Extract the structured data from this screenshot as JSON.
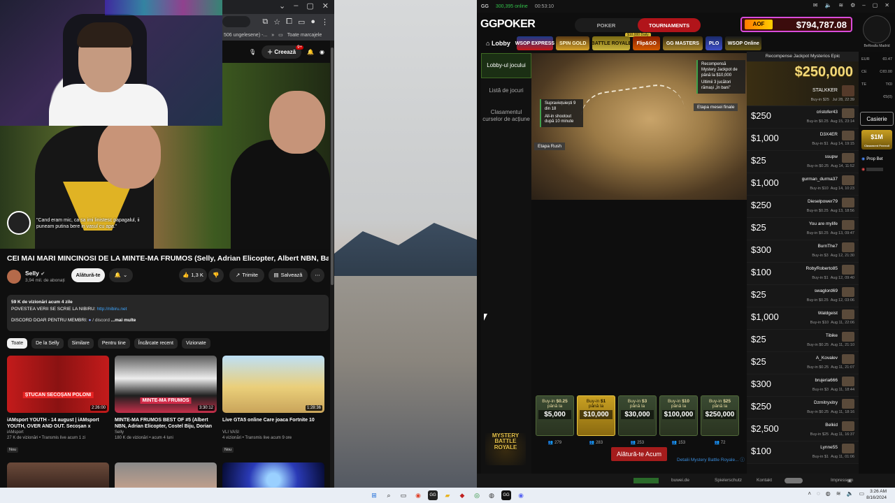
{
  "youtube": {
    "address_text": "506 ungelesene) -...",
    "bookmarks_label": "Toate marcajele",
    "create_label": "Creează",
    "notif_count": "9+",
    "subtitle": "\"Cand eram mic, ca sa imi linistesc papagalul, ii puneam putina bere in vasul cu apa.\"",
    "video_title": "CEI MAI MARI MINCINOSI DE LA MINTE-MA FRUMOS (Selly, Adrian Elicopter, Albert NBN, Babasha)",
    "channel": {
      "name": "Selly",
      "subs": "3,94 mil. de abonați",
      "join": "Alătură-te"
    },
    "actions": {
      "likes": "1,3 K",
      "share": "Trimite",
      "save": "Salvează"
    },
    "description": {
      "stats": "59 K de vizionări  acum 4 zile",
      "line1": "POVESTEA VERII SE SCRIE LA NIBIRU:",
      "link": "http://nibiru.net",
      "line2": "DISCORD DOAR PENTRU MEMBRI:",
      "line2_rest": "/ discord",
      "more": "...mai multe"
    },
    "chips": [
      "Toate",
      "De la Selly",
      "Similare",
      "Pentru tine",
      "Încărcate recent",
      "Vizionate"
    ],
    "videos": [
      {
        "title": "iAMsport YOUTH - 14 august | iAMsport YOUTH, OVER AND OUT. Secoșan x Știucan x ...",
        "channel": "iAMsport",
        "meta": "27 K de vizionări • Transmis live acum 1 zi",
        "badge": "Nou",
        "duration": "2:26:00",
        "thumb_label": "ȘTUCAN  SECOȘAN  POLONI"
      },
      {
        "title": "MINTE-MA FRUMOS BEST OF #5 (Albert NBN, Adrian Elicopter, Costel Biju, Dorian Popa & ...",
        "channel": "Selly",
        "meta": "180 K de vizionări • acum 4 luni",
        "badge": "",
        "duration": "3:30:12",
        "thumb_label": "MINTE-MA FRUMOS"
      },
      {
        "title": "Live GTA5 online Care joaca Fortnite 10",
        "channel": "VLI VASI",
        "meta": "4 vizionări • Transmis live acum 9 ore",
        "badge": "Nou",
        "duration": "1:28:36",
        "thumb_label": ""
      }
    ]
  },
  "gg": {
    "online": "300,395 online",
    "clock": "00:53:10",
    "logo": "GGPOKER",
    "tabs": [
      "POKER",
      "TOURNAMENTS"
    ],
    "jackpot": "$794,787.08",
    "club": "BeRealla Madrid",
    "nav": [
      "Lobby",
      "WSOP EXPRESS",
      "SPIN GOLD",
      "BATTLE ROYALE",
      "Flip&GO",
      "GG MASTERS",
      "PLO",
      "WSOP Online"
    ],
    "daily_tag": "$10,000 Daily",
    "side": [
      "Lobby-ul jocului",
      "Listă de jocuri",
      "Clasamentul curselor de acțiune"
    ],
    "mbr_logo": "MYSTERY BATTLE ROYALE",
    "map": {
      "tag1": "Recompensă Mystery Jackpot de până la $10,000",
      "tag2": "Ultimii 3 jucători rămași „în bani”",
      "tag3": "Supraviețuiești 9 din 18",
      "tag4": "All-in shootout după 10 minute",
      "etapa_rush": "Etapa Rush",
      "etapa_finala": "Etapa mesei finale"
    },
    "buyins": [
      {
        "buy": "$0.25",
        "upto": "$5,000",
        "entrants": "279"
      },
      {
        "buy": "$1",
        "upto": "$10,000",
        "entrants": "283"
      },
      {
        "buy": "$3",
        "upto": "$30,000",
        "entrants": "253"
      },
      {
        "buy": "$10",
        "upto": "$100,000",
        "entrants": "153"
      },
      {
        "buy": "$25",
        "upto": "$250,000",
        "entrants": "72"
      }
    ],
    "buyin_word": "Buy-in",
    "upto_word": "până la",
    "join_now": "Alătură-te Acum",
    "details_link": "Detalii Mystery Battle Royale...",
    "winners_header": "Recompense Jackpot Mysterios Epic",
    "top_winner": {
      "amount": "$250,000",
      "name": "STALKKER",
      "buyin": "$25",
      "date": "Jul 28, 22:39"
    },
    "winners": [
      {
        "amount": "$250",
        "name": "cristofer43",
        "buyin": "$0.25",
        "date": "Aug 15, 23:14"
      },
      {
        "amount": "$1,000",
        "name": "D3X4ER",
        "buyin": "$1",
        "date": "Aug 14, 19:15"
      },
      {
        "amount": "$25",
        "name": "ssupw",
        "buyin": "$0.25",
        "date": "Aug 14, 11:52"
      },
      {
        "amount": "$1,000",
        "name": "gurman_durma37",
        "buyin": "$10",
        "date": "Aug 14, 10:23"
      },
      {
        "amount": "$250",
        "name": "Dieselpower79",
        "buyin": "$0.25",
        "date": "Aug 13, 18:56"
      },
      {
        "amount": "$25",
        "name": "You are mylife",
        "buyin": "$0.25",
        "date": "Aug 13, 09:47"
      },
      {
        "amount": "$300",
        "name": "BurnThe7",
        "buyin": "$3",
        "date": "Aug 12, 21:30"
      },
      {
        "amount": "$100",
        "name": "RobyRoberto85",
        "buyin": "$1",
        "date": "Aug 12, 09:40"
      },
      {
        "amount": "$25",
        "name": "swaglord69",
        "buyin": "$0.25",
        "date": "Aug 12, 03:06"
      },
      {
        "amount": "$1,000",
        "name": "Waldgeist",
        "buyin": "$10",
        "date": "Aug 11, 22:06"
      },
      {
        "amount": "$25",
        "name": "Tibike",
        "buyin": "$0.25",
        "date": "Aug 11, 21:10"
      },
      {
        "amount": "$25",
        "name": "A_Kovalev",
        "buyin": "$0.25",
        "date": "Aug 11, 21:07"
      },
      {
        "amount": "$300",
        "name": "brujeria666",
        "buyin": "$3",
        "date": "Aug 11, 18:44"
      },
      {
        "amount": "$250",
        "name": "Dzmitryxitry",
        "buyin": "$0.25",
        "date": "Aug 11, 18:16"
      },
      {
        "amount": "$2,500",
        "name": "Belkid",
        "buyin": "$25",
        "date": "Aug 11, 16:37"
      },
      {
        "amount": "$100",
        "name": "Lynne55",
        "buyin": "$1",
        "date": "Aug 11, 01:06"
      }
    ],
    "balances": [
      {
        "cur": "EUR",
        "val": "€0.47"
      },
      {
        "cur": "CE",
        "val": "C€0.00"
      },
      {
        "cur": "TE",
        "val": "T€0"
      },
      {
        "cur": "",
        "val": "€5(0)"
      }
    ],
    "cashier": "Casierie",
    "freeroll": "$1M",
    "freeroll_sub": "Clasament Freeroll",
    "propbet": "Prop Bet",
    "footer": {
      "a": "buwei.de",
      "b": "Spielerschutz",
      "c": "Kontakt",
      "d": "Impressum"
    }
  },
  "taskbar": {
    "time": "3:26 AM",
    "date": "8/16/2024"
  }
}
